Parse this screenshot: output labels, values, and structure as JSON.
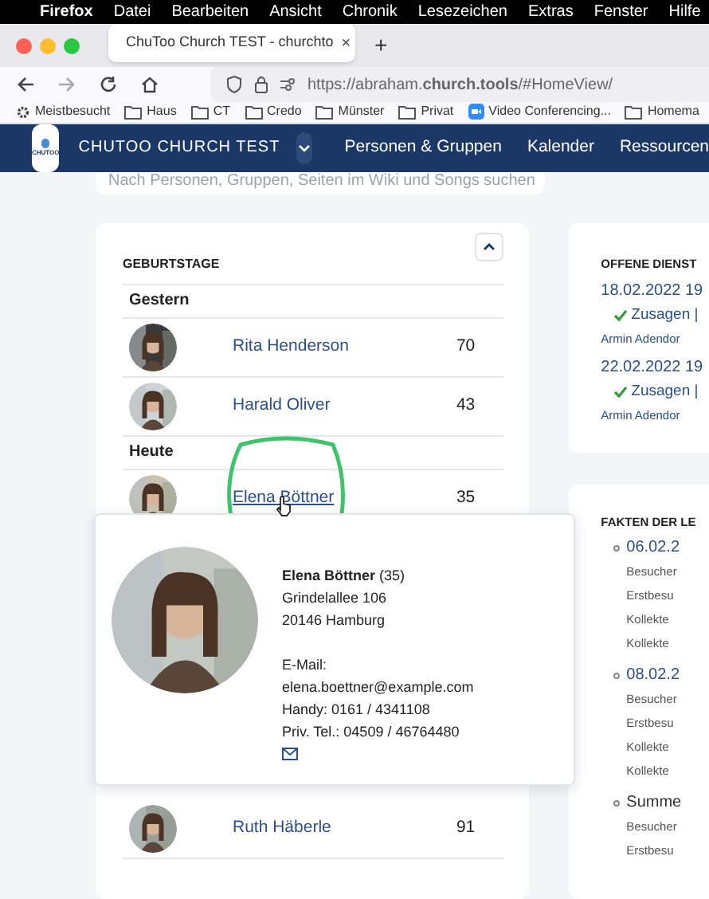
{
  "os_menu_bar": {
    "items": [
      "Firefox",
      "Datei",
      "Bearbeiten",
      "Ansicht",
      "Chronik",
      "Lesezeichen",
      "Extras",
      "Fenster",
      "Hilfe"
    ]
  },
  "browser": {
    "tabs": [
      {
        "title": "ChuToo Church TEST - churchto",
        "selected": true
      }
    ],
    "new_tab": "+",
    "close": "×",
    "url": "https://abraham.**church.tools**/#HomeView/",
    "bookmarks": [
      {
        "label": "Meistbesucht",
        "kind": "gear"
      },
      {
        "label": "Haus",
        "kind": "folder"
      },
      {
        "label": "CT",
        "kind": "folder"
      },
      {
        "label": "Credo",
        "kind": "folder"
      },
      {
        "label": "Münster",
        "kind": "folder"
      },
      {
        "label": "Privat",
        "kind": "folder"
      },
      {
        "label": "Video Conferencing...",
        "kind": "video"
      },
      {
        "label": "Homema",
        "kind": "folder"
      }
    ]
  },
  "app_nav": {
    "logo_text": "CHUTOO",
    "brand": "CHUTOO CHURCH TEST",
    "items": [
      "Personen & Gruppen",
      "Kalender",
      "Ressourcen"
    ]
  },
  "search": {
    "placeholder": "Nach Personen, Gruppen, Seiten im Wiki und Songs suchen"
  },
  "birthdays": {
    "title": "GEBURTSTAGE",
    "expanded": true,
    "groups": [
      {
        "label": "Gestern",
        "people": [
          {
            "name": "Rita Henderson",
            "age": "70",
            "hovered": false
          },
          {
            "name": "Harald Oliver",
            "age": "43",
            "hovered": false
          }
        ]
      },
      {
        "label": "Heute",
        "people": [
          {
            "name": "Elena Böttner",
            "age": "35",
            "hovered": true
          }
        ]
      },
      {
        "people": [
          {
            "name": "Ruth Häberle",
            "age": "91",
            "hovered": false
          }
        ]
      }
    ]
  },
  "hover_card": {
    "name": "Elena Böttner",
    "age": "(35)",
    "address": [
      "Grindelallee 106",
      "20146 Hamburg"
    ],
    "email_label": "E-Mail:",
    "email": "elena.boettner@example.com",
    "phones": [
      "Handy: 0161 / 4341108",
      "Priv. Tel.: 04509 / 46764480"
    ]
  },
  "services": {
    "title": "OFFENE DIENST",
    "items": [
      {
        "date": "18.02.2022 19",
        "action": "Zusagen |",
        "person": "Armin Adendor"
      },
      {
        "date": "22.02.2022 19",
        "action": "Zusagen |",
        "person": "Armin Adendor"
      }
    ]
  },
  "facts": {
    "title": "FAKTEN DER LE",
    "entries": [
      {
        "heading": "06.02.2",
        "kind": "date",
        "lines": [
          "Besucher",
          "Erstbesu",
          "Kollekte",
          "Kollekte"
        ]
      },
      {
        "heading": "08.02.2",
        "kind": "date",
        "lines": [
          "Besucher",
          "Erstbesu",
          "Kollekte",
          "Kollekte"
        ]
      },
      {
        "heading": "Summe",
        "kind": "total",
        "lines": [
          "Besucher",
          "Erstbesu"
        ]
      }
    ]
  }
}
